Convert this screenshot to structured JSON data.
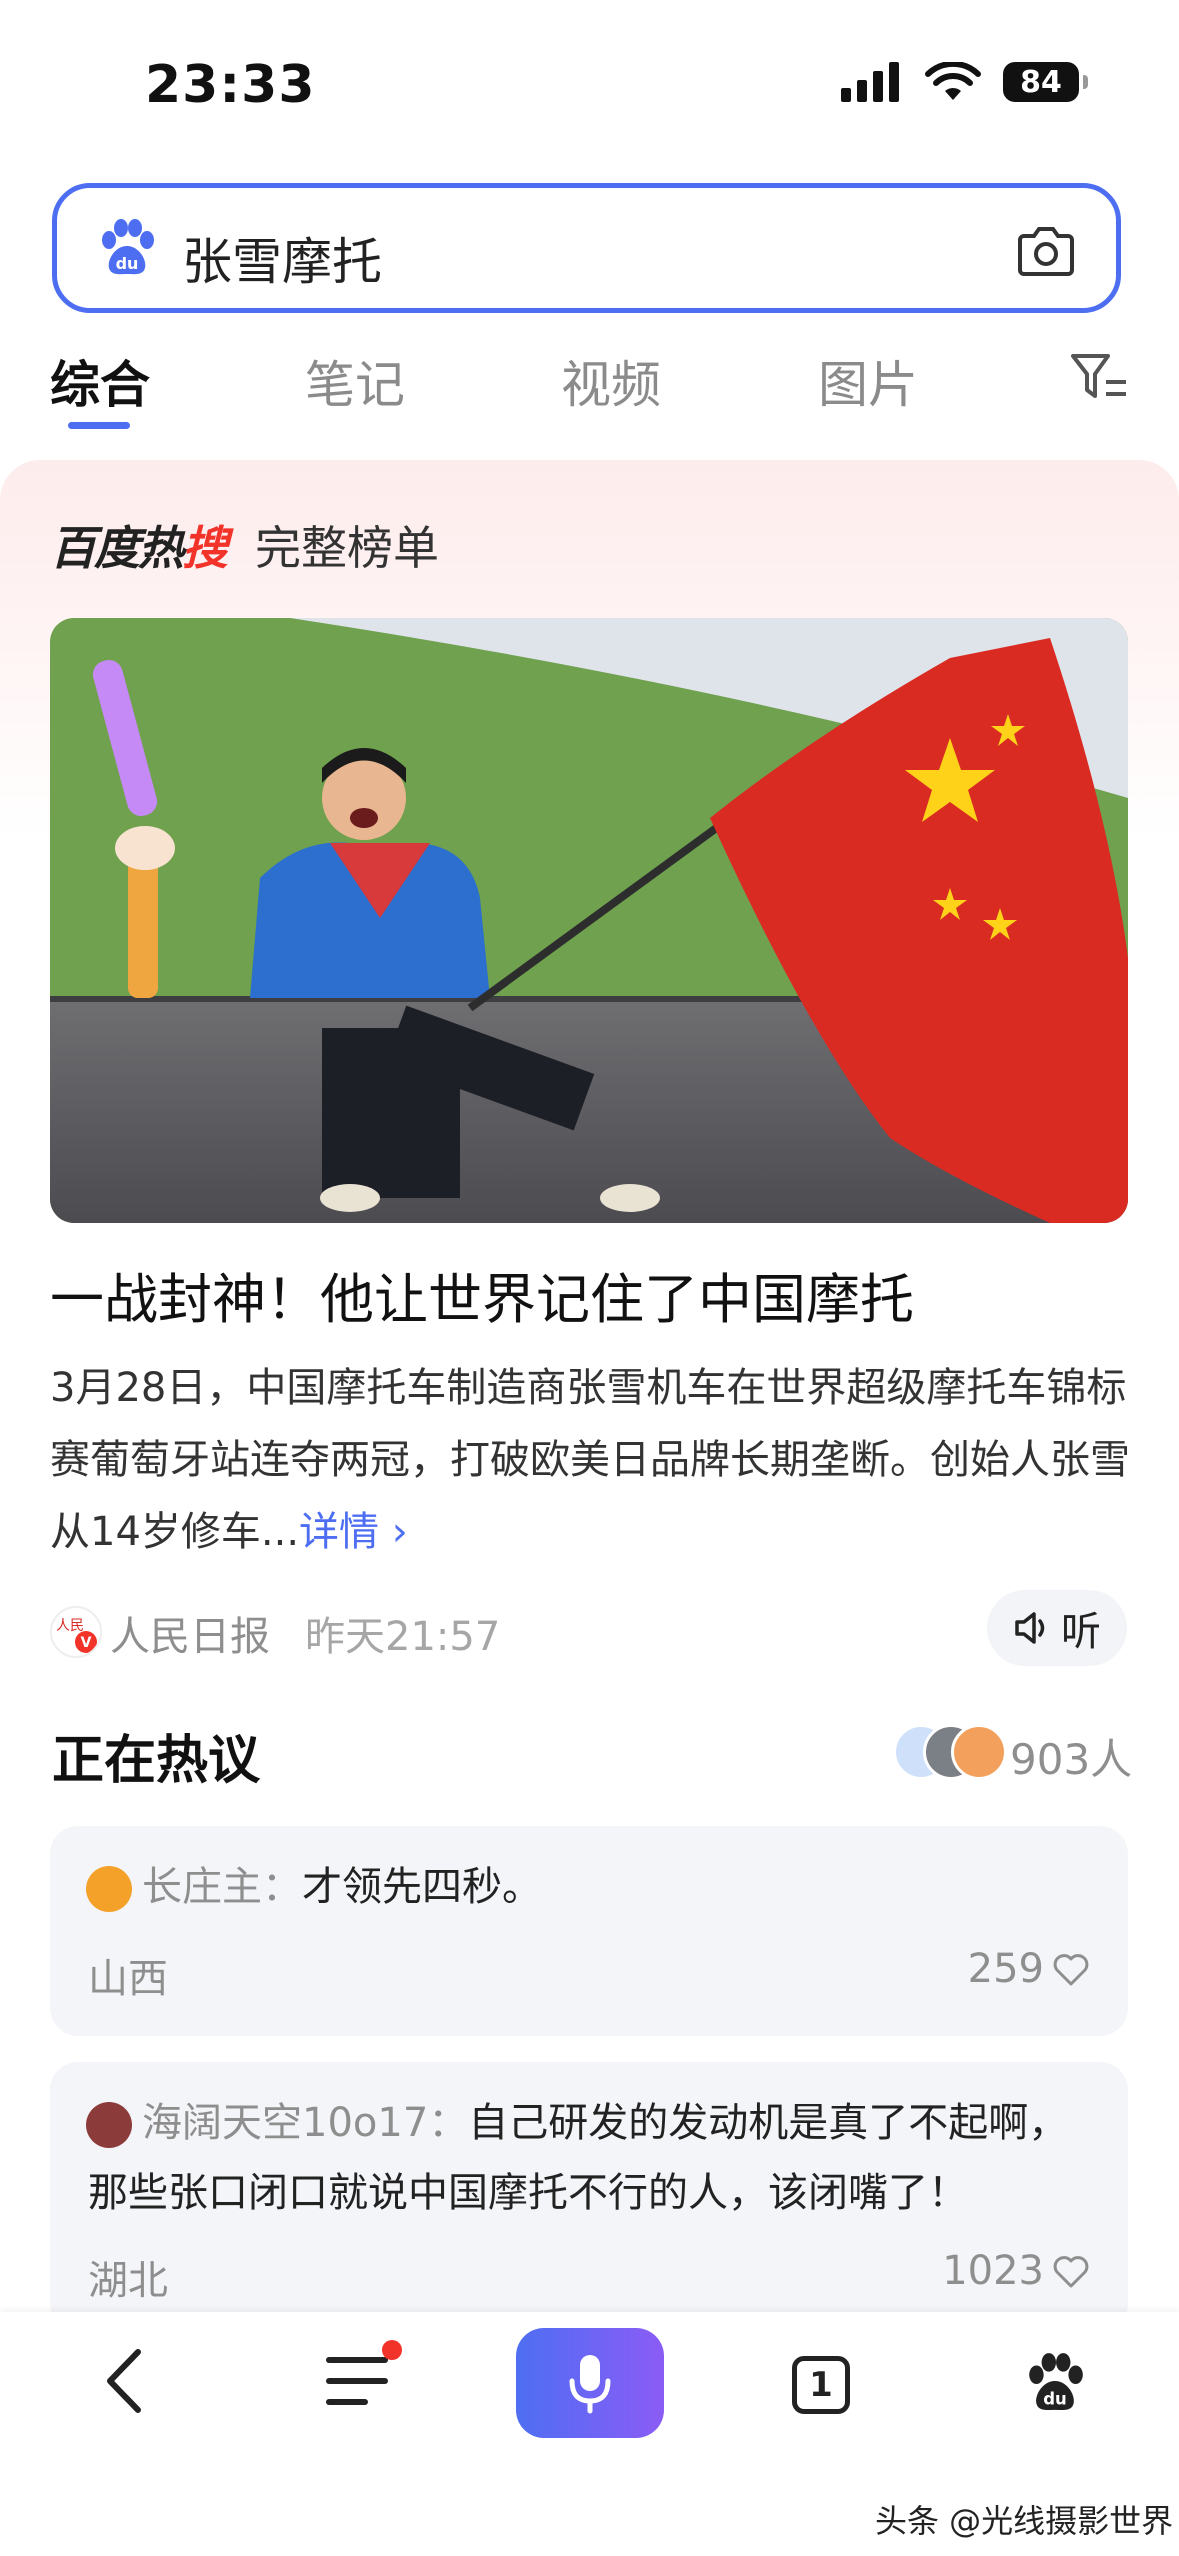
{
  "status": {
    "time": "23:33",
    "battery": "84"
  },
  "search": {
    "query": "张雪摩托"
  },
  "tabs": [
    {
      "label": "综合",
      "active": true
    },
    {
      "label": "笔记",
      "active": false
    },
    {
      "label": "视频",
      "active": false
    },
    {
      "label": "图片",
      "active": false
    }
  ],
  "hot": {
    "brand_a": "百度热",
    "brand_b": "搜",
    "full_list": "完整榜单"
  },
  "article": {
    "headline": "一战封神！他让世界记住了中国摩托",
    "summary": "3月28日，中国摩托车制造商张雪机车在世界超级摩托车锦标赛葡萄牙站连夺两冠，打破欧美日品牌长期垄断。创始人张雪从14岁修车...",
    "more": "详情 ›",
    "source": "人民日报",
    "time": "昨天21:57",
    "listen": "听"
  },
  "discuss": {
    "title": "正在热议",
    "count": "903人",
    "comments": [
      {
        "user": "长庄主：",
        "text": "才领先四秒。",
        "location": "山西",
        "likes": "259"
      },
      {
        "user": "海阔天空10o17：",
        "text": "自己研发的发动机是真了不起啊，那些张口闭口就说中国摩托不行的人，该闭嘴了！",
        "location": "湖北",
        "likes": "1023"
      }
    ]
  },
  "bottom_nav": {
    "tab_count": "1"
  },
  "watermark": "头条 @光线摄影世界",
  "colors": {
    "accent": "#4e6ef2",
    "hot_red": "#f2332a"
  }
}
